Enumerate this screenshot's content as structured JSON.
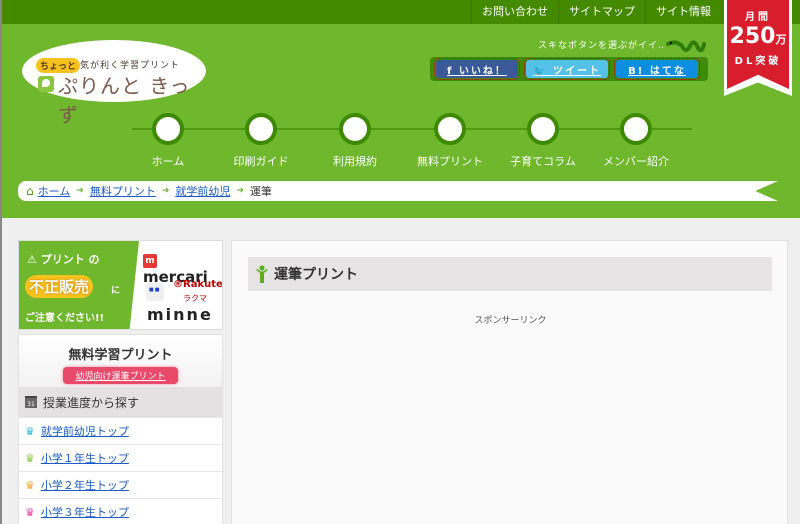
{
  "topnav": [
    "お問い合わせ",
    "サイトマップ",
    "サイト情報"
  ],
  "logo": {
    "tag": "ちょっと",
    "subtitle": "気が利く学習プリント",
    "name": "ぷりんと きっず"
  },
  "share": {
    "caption": "スキなボタンを選ぶがイイ‥",
    "facebook": "f いいね！",
    "twitter": "🐦 ツイート",
    "hatena": "B! はてな"
  },
  "ribbon": {
    "line1": "月間",
    "number": "250",
    "unit": "万",
    "line3": "DL突破"
  },
  "mainnav": [
    "ホーム",
    "印刷ガイド",
    "利用規約",
    "無料プリント",
    "子育てコラム",
    "メンバー紹介"
  ],
  "breadcrumb": {
    "items": [
      "ホーム",
      "無料プリント",
      "就学前幼児"
    ],
    "current": "運筆",
    "separator": "➜"
  },
  "banner": {
    "line1": "⚠ プリント の",
    "line2": "不正販売",
    "line2b": "に",
    "line3": "ご注意ください!!",
    "mercari": "mercari",
    "rakuten": "®Rakuten",
    "rakuma": "ラクマ",
    "minne": "minne"
  },
  "widget": {
    "title": "無料学習プリント",
    "pill": "幼児向け運筆プリント",
    "section": "授業進度から探す",
    "cal_icon_text": "31",
    "grades": [
      {
        "label": "就学前幼児トップ",
        "color": "#2fb5e6"
      },
      {
        "label": "小学１年生トップ",
        "color": "#8cc63f"
      },
      {
        "label": "小学２年生トップ",
        "color": "#f5a623"
      },
      {
        "label": "小学３年生トップ",
        "color": "#e93d9b"
      }
    ]
  },
  "content": {
    "title": "運筆プリント",
    "sponsor": "スポンサーリンク"
  },
  "colors": {
    "header_green": "#6fb82d",
    "topbar_green": "#448a00",
    "ribbon_red": "#d81e2c"
  }
}
